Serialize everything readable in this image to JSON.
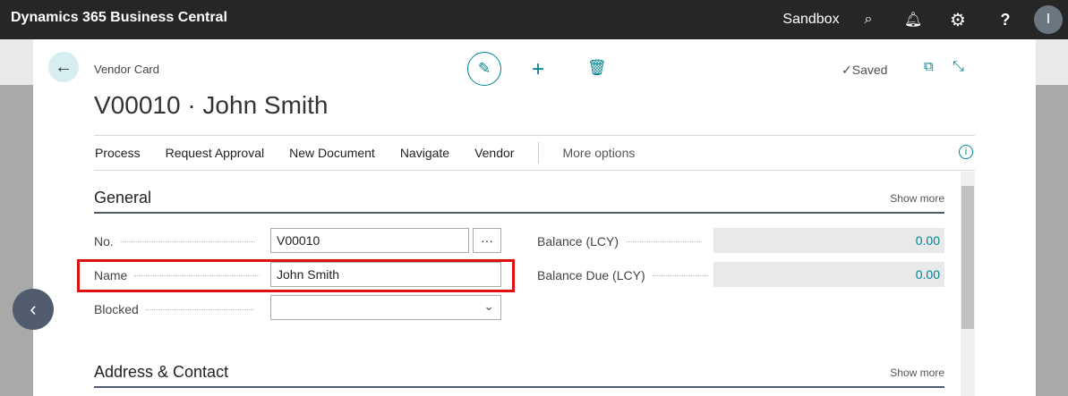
{
  "topbar": {
    "app_title": "Dynamics 365 Business Central",
    "environment": "Sandbox",
    "avatar_initial": "I"
  },
  "header": {
    "breadcrumb": "Vendor Card",
    "title": "V00010 · John Smith",
    "status": "✓Saved"
  },
  "actions": [
    "Process",
    "Request Approval",
    "New Document",
    "Navigate",
    "Vendor"
  ],
  "more_options": "More options",
  "general": {
    "title": "General",
    "show_more": "Show more",
    "no_label": "No.",
    "no_value": "V00010",
    "assist": "···",
    "name_label": "Name",
    "name_value": "John Smith",
    "blocked_label": "Blocked",
    "blocked_value": "",
    "balance_label": "Balance (LCY)",
    "balance_value": "0.00",
    "balance_due_label": "Balance Due (LCY)",
    "balance_due_value": "0.00"
  },
  "address": {
    "title": "Address & Contact",
    "show_more": "Show more"
  },
  "colors": {
    "accent": "#00838f",
    "highlight": "#e01010",
    "topbar": "#262626"
  }
}
